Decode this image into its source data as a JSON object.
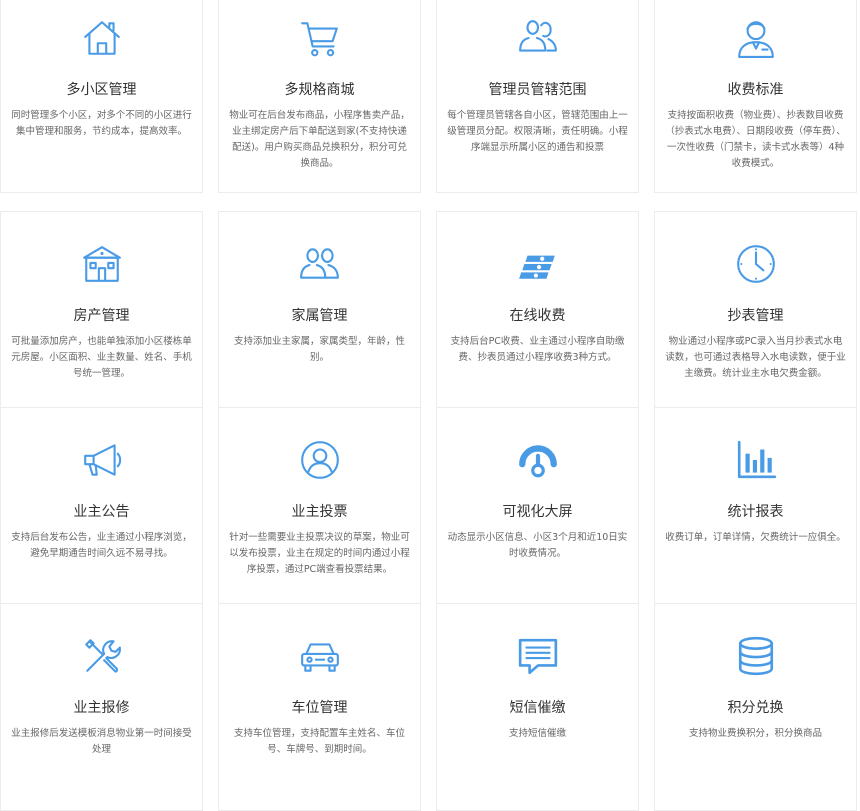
{
  "features": [
    {
      "title": "多小区管理",
      "desc": "同时管理多个小区，对多个不同的小区进行集中管理和服务，节约成本，提高效率。",
      "icon": "house-icon"
    },
    {
      "title": "多规格商城",
      "desc": "物业可在后台发布商品，小程序售卖产品，业主绑定房产后下单配送到家(不支持快递配送)。用户购买商品兑换积分，积分可兑换商品。",
      "icon": "cart-icon"
    },
    {
      "title": "管理员管辖范围",
      "desc": "每个管理员管辖各自小区，管辖范围由上一级管理员分配。权限清晰，责任明确。小程序端显示所属小区的通告和投票",
      "icon": "users-icon"
    },
    {
      "title": "收费标准",
      "desc": "支持按面积收费（物业费）、抄表数目收费（抄表式水电费）、日期段收费（停车费）、一次性收费（门禁卡，读卡式水表等）4种收费模式。",
      "icon": "staff-icon"
    },
    {
      "title": "房产管理",
      "desc": "可批量添加房产，也能单独添加小区楼栋单元房屋。小区面积、业主数量、姓名、手机号统一管理。",
      "icon": "building-icon"
    },
    {
      "title": "家属管理",
      "desc": "支持添加业主家属，家属类型，年龄，性别。",
      "icon": "family-icon"
    },
    {
      "title": "在线收费",
      "desc": "支持后台PC收费、业主通过小程序自助缴费、抄表员通过小程序收费3种方式。",
      "icon": "money-icon"
    },
    {
      "title": "抄表管理",
      "desc": "物业通过小程序或PC录入当月抄表式水电读数，也可通过表格导入水电读数，便于业主缴费。统计业主水电欠费金额。",
      "icon": "clock-icon"
    },
    {
      "title": "业主公告",
      "desc": "支持后台发布公告，业主通过小程序浏览，避免早期通告时间久远不易寻找。",
      "icon": "megaphone-icon"
    },
    {
      "title": "业主投票",
      "desc": "针对一些需要业主投票决议的草案，物业可以发布投票，业主在规定的时间内通过小程序投票，通过PC端查看投票结果。",
      "icon": "person-circle-icon"
    },
    {
      "title": "可视化大屏",
      "desc": "动态显示小区信息、小区3个月和近10日实时收费情况。",
      "icon": "gauge-icon"
    },
    {
      "title": "统计报表",
      "desc": "收费订单，订单详情，欠费统计一应俱全。",
      "icon": "bar-chart-icon"
    },
    {
      "title": "业主报修",
      "desc": "业主报修后发送模板消息物业第一时间接受处理",
      "icon": "tools-icon"
    },
    {
      "title": "车位管理",
      "desc": "支持车位管理，支持配置车主姓名、车位号、车牌号、到期时间。",
      "icon": "car-icon"
    },
    {
      "title": "短信催缴",
      "desc": "支持短信催缴",
      "icon": "message-icon"
    },
    {
      "title": "积分兑换",
      "desc": "支持物业费换积分，积分换商品",
      "icon": "database-icon"
    }
  ]
}
